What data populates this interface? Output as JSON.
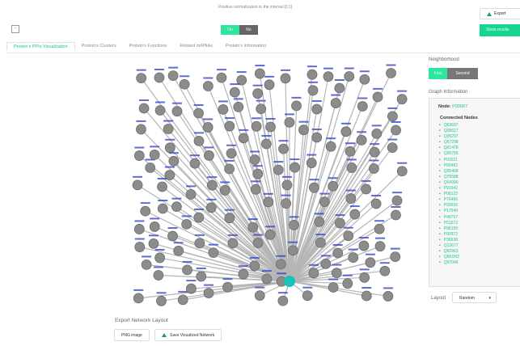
{
  "header": {
    "top_text": "Positive normalization to the interval [0,1]",
    "export_label": "Export",
    "toggle_on": "On",
    "toggle_off": "No",
    "show_results": "Show results",
    "collapse": "-"
  },
  "tabs": [
    "Protein's PPIs Visualization",
    "Protein's Clusters",
    "Protein's Functions",
    "Related miRNAs",
    "Protein's Information"
  ],
  "right_panel": {
    "neighborhood_title": "Neighborhood",
    "nb_on": "First",
    "nb_off": "Second",
    "graph_info_title": "Graph Information",
    "node_label": "Node:",
    "node_value": "P00067",
    "connected_title": "Connected Nodes",
    "connected_nodes": [
      "Q63697",
      "Q08627",
      "Q05297",
      "Q67298",
      "Q61478",
      "Q95789",
      "P91021",
      "P00462",
      "Q95468",
      "Q75588",
      "Q64990",
      "P91942",
      "P08122",
      "P76490",
      "P30016",
      "P17549",
      "P48757",
      "P51572",
      "P96159",
      "P90572",
      "P36638",
      "Q13677",
      "Q60963",
      "Q8K0H2",
      "Q97046"
    ],
    "layout_label": "Layout",
    "layout_value": "Random",
    "layout_chevron": "▾"
  },
  "footer": {
    "export_title": "Export Network Layout",
    "png_button": "PNG image",
    "save_button": "Save Visualized Network"
  },
  "graph": {
    "center_color": "#19c3b9",
    "node_color": "#8c8c8c",
    "edge_color": "#b5b5b5",
    "label_color": "#3548c8"
  }
}
